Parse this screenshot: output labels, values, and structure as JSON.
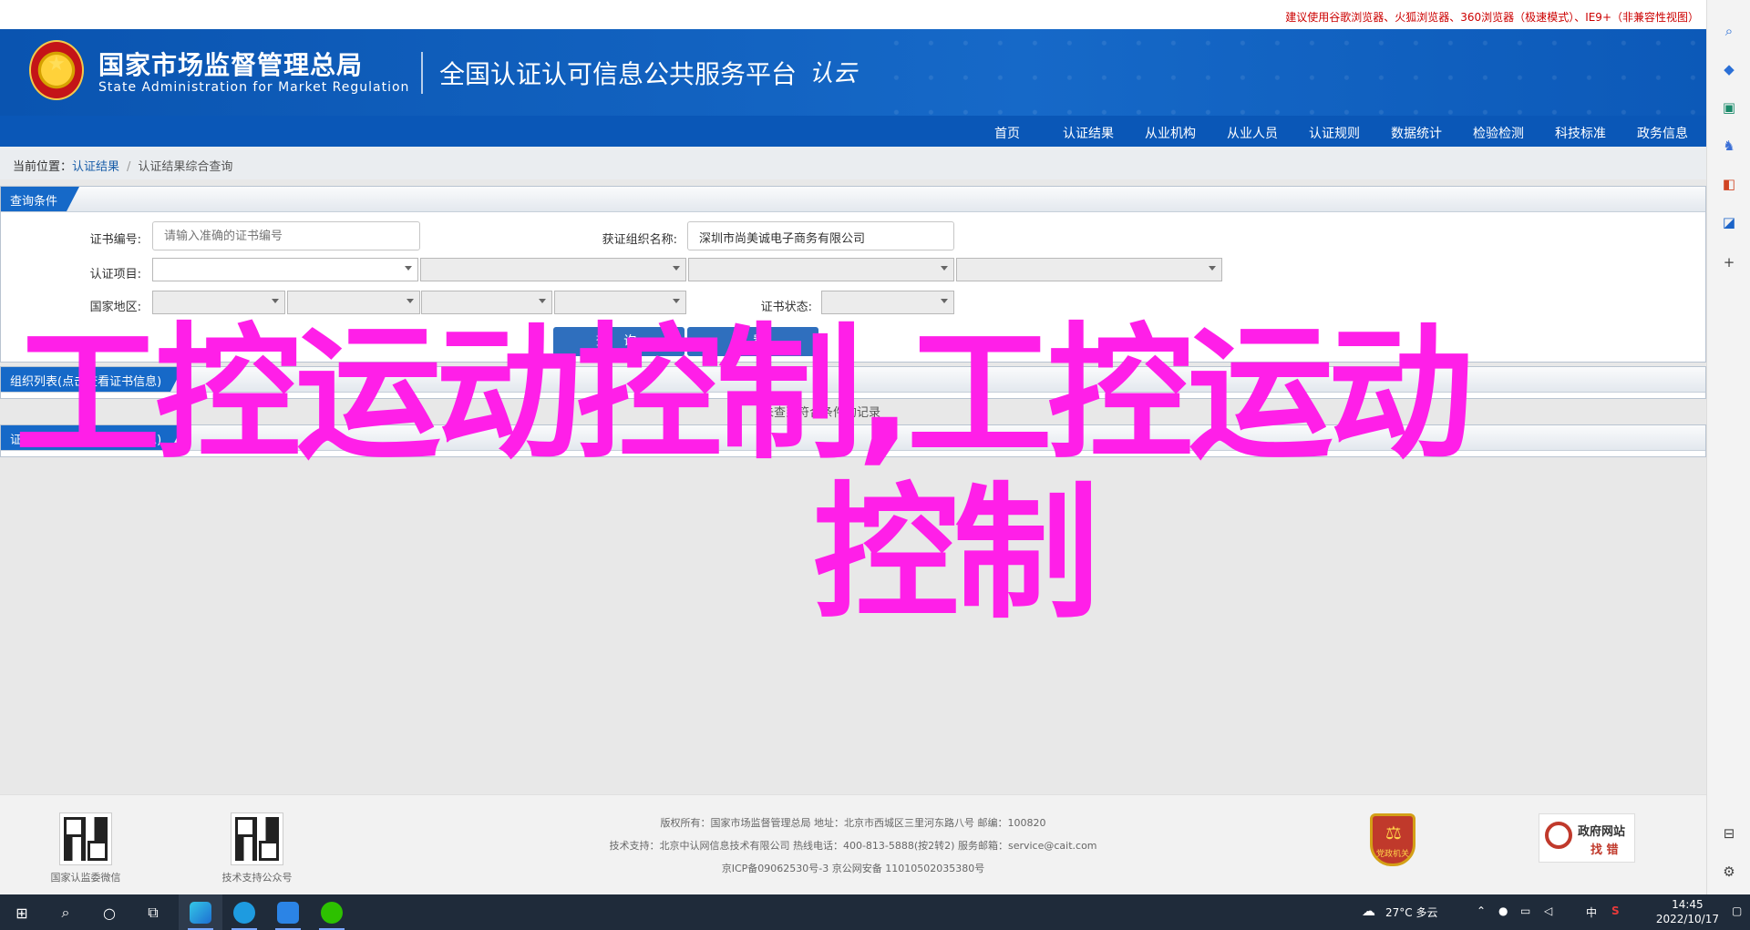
{
  "notice": "建议使用谷歌浏览器、火狐浏览器、360浏览器（极速模式）、IE9+（非兼容性视图）",
  "header": {
    "org_cn": "国家市场监督管理总局",
    "org_en": "State Administration  for  Market Regulation",
    "platform": "全国认证认可信息公共服务平台",
    "cloud_logo": "认云"
  },
  "nav": [
    "首页",
    "认证结果",
    "从业机构",
    "从业人员",
    "认证规则",
    "数据统计",
    "检验检测",
    "科技标准",
    "政务信息"
  ],
  "breadcrumb": {
    "label": "当前位置：",
    "link": "认证结果",
    "sep": "/",
    "current": "认证结果综合查询"
  },
  "query": {
    "tab": "查询条件",
    "cert_no_label": "证书编号:",
    "cert_no_placeholder": "请输入准确的证书编号",
    "org_name_label": "获证组织名称:",
    "org_name_value": "深圳市尚美诚电子商务有限公司",
    "project_label": "认证项目:",
    "region_label": "国家地区:",
    "status_label": "证书状态:",
    "search_btn": "查 询",
    "reset_btn": "重置"
  },
  "org_list": {
    "tab": "组织列表(点击查看证书信息)",
    "message": "未查到符合条件的记录"
  },
  "cert_list": {
    "tab": "证书列表(点击查看详细信息)"
  },
  "overlay": {
    "line1": "工控运动控制,工控运动",
    "line2": "控制"
  },
  "footer": {
    "qr1_caption": "国家认监委微信",
    "qr2_caption": "技术支持公众号",
    "line1": "版权所有：国家市场监督管理总局    地址：北京市西城区三里河东路八号    邮编：100820",
    "line2": "技术支持：北京中认网信息技术有限公司    热线电话：400-813-5888(按2转2)    服务邮箱：service@cait.com",
    "line3": "京ICP备09062530号-3    京公网安备   11010502035380号",
    "badge": "党政机关",
    "gov_t1": "政府网站",
    "gov_t2": "找 错"
  },
  "taskbar": {
    "weather": "27°C  多云",
    "ime": "中",
    "time": "14:45",
    "date": "2022/10/17"
  },
  "colors": {
    "brand_blue": "#0a57b7",
    "overlay": "#ff1fe8",
    "notice_red": "#cc0000"
  }
}
